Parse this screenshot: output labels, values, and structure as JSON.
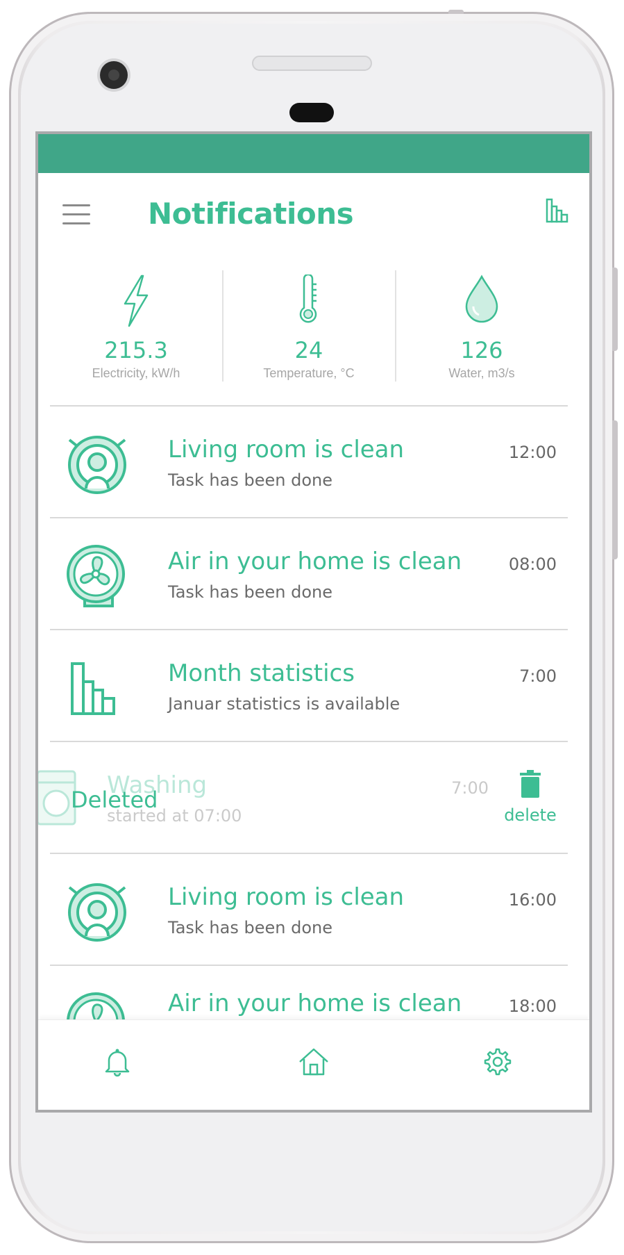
{
  "header": {
    "title": "Notifications"
  },
  "metrics": [
    {
      "value": "215.3",
      "label": "Electricity, kW/h",
      "icon": "lightning-icon"
    },
    {
      "value": "24",
      "label": "Temperature, °C",
      "icon": "thermometer-icon"
    },
    {
      "value": "126",
      "label": "Water, m3/s",
      "icon": "water-drop-icon"
    }
  ],
  "notifications": [
    {
      "title": "Living room is clean",
      "subtitle": "Task has been done",
      "time": "12:00",
      "icon": "robot-vacuum-icon"
    },
    {
      "title": "Air in your home is clean",
      "subtitle": "Task has been done",
      "time": "08:00",
      "icon": "fan-icon"
    },
    {
      "title": "Month statistics",
      "subtitle": "Januar statistics is available",
      "time": "7:00",
      "icon": "bar-chart-icon"
    },
    {
      "title": "Washing",
      "subtitle": "started at 07:00",
      "time": "7:00",
      "icon": "washing-machine-icon",
      "swipe_label": "Deleted",
      "action_label": "delete"
    },
    {
      "title": "Living room is clean",
      "subtitle": "Task has been done",
      "time": "16:00",
      "icon": "robot-vacuum-icon"
    },
    {
      "title": "Air in your home is clean",
      "subtitle": "",
      "time": "18:00",
      "icon": "fan-icon"
    }
  ],
  "bottom_nav": [
    "bell-icon",
    "home-icon",
    "settings-icon"
  ],
  "colors": {
    "accent": "#3dbd93",
    "statusbar": "#40a688",
    "icon_fill": "#cdeee2"
  }
}
